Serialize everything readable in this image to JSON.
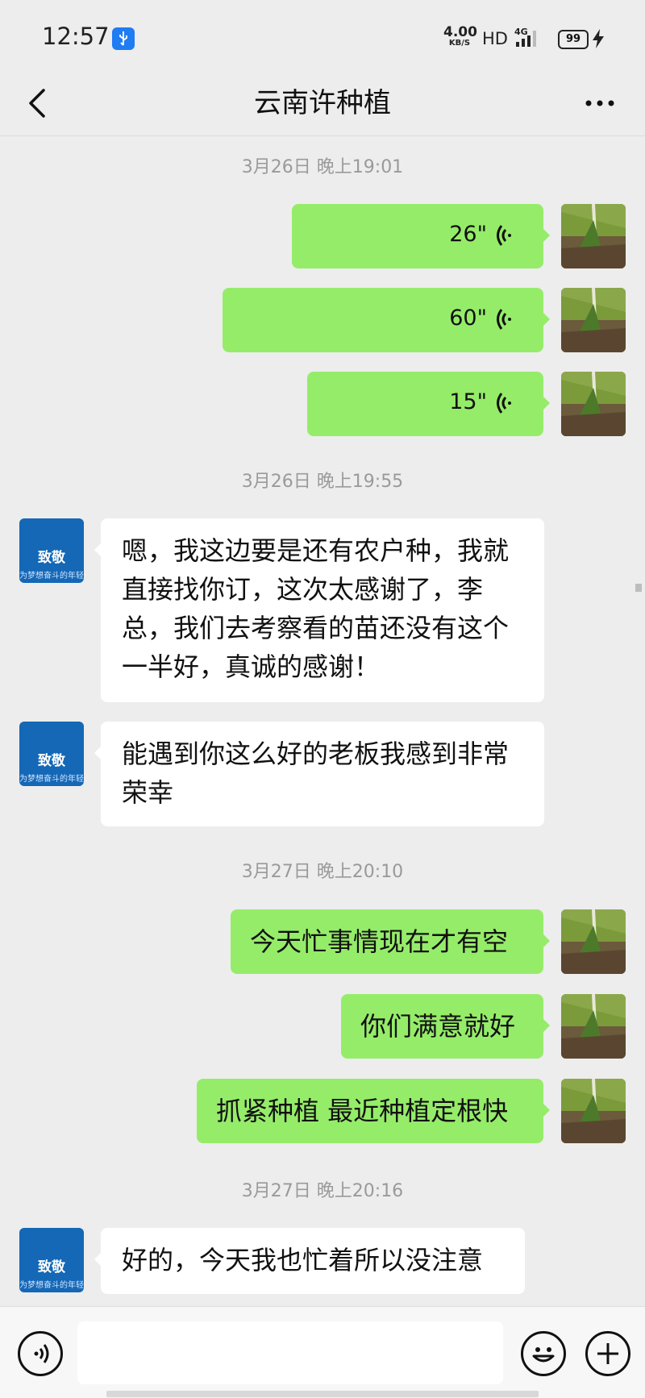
{
  "status_bar": {
    "time": "12:57",
    "net_speed_value": "4.00",
    "net_speed_unit": "KB/S",
    "hd_label": "HD",
    "network_type": "4G",
    "battery_level": "99"
  },
  "header": {
    "title": "云南许种植"
  },
  "timestamps": {
    "t1": "3月26日 晚上19:01",
    "t2": "3月26日 晚上19:55",
    "t3": "3月27日 晚上20:10",
    "t4": "3月27日 晚上20:16"
  },
  "messages": {
    "voice1": "26\"",
    "voice2": "60\"",
    "voice3": "15\"",
    "incoming1": "嗯，我这边要是还有农户种，我就直接找你订，这次太感谢了，李总，我们去考察看的苗还没有这个一半好，真诚的感谢！",
    "incoming2": "能遇到你这么好的老板我感到非常荣幸",
    "out1": "今天忙事情现在才有空",
    "out2": "你们满意就好",
    "out3": "抓紧种植 最近种植定根快",
    "incoming3": "好的，今天我也忙着所以没注意"
  },
  "contact_avatar": {
    "line1": "致敬",
    "line2": "为梦想奋斗的年轻人"
  },
  "colors": {
    "outgoing_bubble": "#95ec69",
    "incoming_bubble": "#ffffff",
    "background": "#ededed",
    "avatar_blue": "#1468b6"
  },
  "icons": {
    "back": "chevron-left-icon",
    "more": "more-dots-icon",
    "voice": "voice-wave-icon",
    "emoji": "emoji-icon",
    "plus": "plus-icon",
    "usb": "usb-icon"
  }
}
